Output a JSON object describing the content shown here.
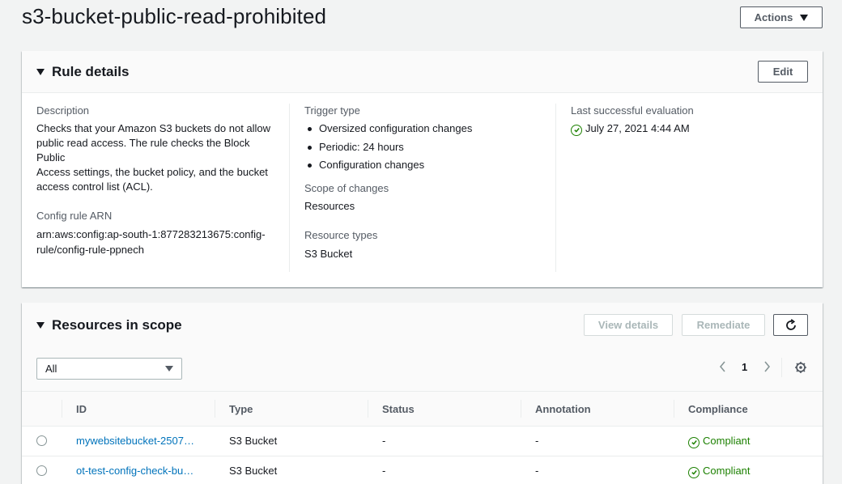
{
  "page": {
    "title": "s3-bucket-public-read-prohibited",
    "actions_label": "Actions"
  },
  "rule_details": {
    "title": "Rule details",
    "edit_label": "Edit",
    "description_label": "Description",
    "description_lines": [
      "Checks that your Amazon S3 buckets do not allow",
      "public read access. The rule checks the Block Public",
      "Access settings, the bucket policy, and the bucket",
      "access control list (ACL)."
    ],
    "arn_label": "Config rule ARN",
    "arn_lines": [
      "arn:aws:config:ap-south-1:877283213675:config-",
      "rule/config-rule-ppnech"
    ],
    "trigger_type_label": "Trigger type",
    "trigger_types": [
      "Oversized configuration changes",
      "Periodic: 24 hours",
      "Configuration changes"
    ],
    "scope_label": "Scope of changes",
    "scope_value": "Resources",
    "resource_types_label": "Resource types",
    "resource_types_value": "S3 Bucket",
    "last_eval_label": "Last successful evaluation",
    "last_eval_value": "July 27, 2021 4:44 AM"
  },
  "resources": {
    "title": "Resources in scope",
    "view_details_label": "View details",
    "remediate_label": "Remediate",
    "filter_value": "All",
    "page_number": "1",
    "columns": [
      "ID",
      "Type",
      "Status",
      "Annotation",
      "Compliance"
    ],
    "rows": [
      {
        "id": "mywebsitebucket-2507…",
        "type": "S3 Bucket",
        "status": "-",
        "annotation": "-",
        "compliance": "Compliant"
      },
      {
        "id": "ot-test-config-check-bu…",
        "type": "S3 Bucket",
        "status": "-",
        "annotation": "-",
        "compliance": "Compliant"
      }
    ]
  },
  "colors": {
    "link": "#0073bb",
    "success": "#1d8102",
    "border": "#545b64"
  }
}
